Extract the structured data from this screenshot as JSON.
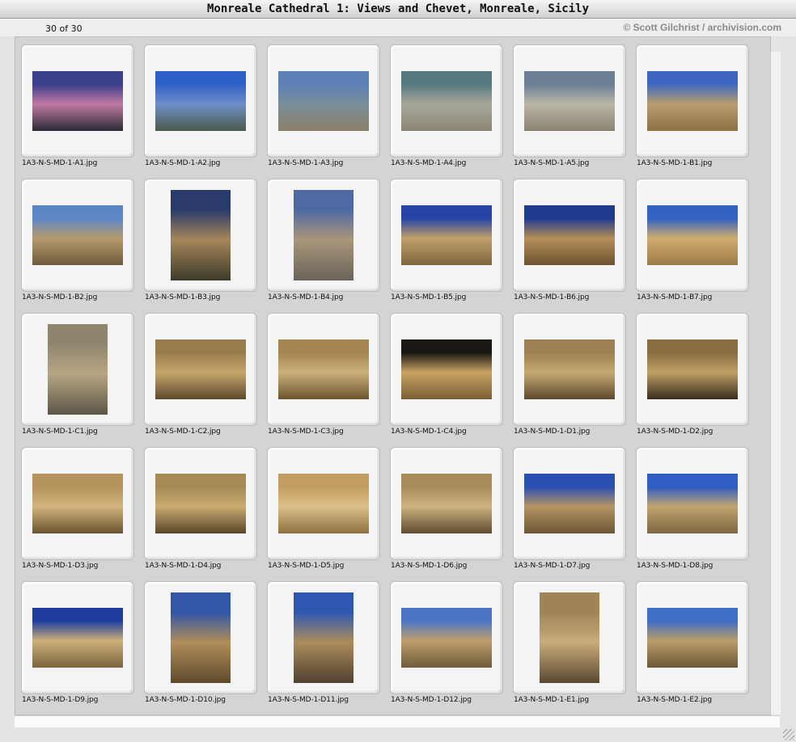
{
  "window": {
    "title": "Monreale Cathedral 1: Views and Chevet, Monreale, Sicily"
  },
  "info": {
    "count": "30 of 30",
    "copyright": "© Scott Gilchrist / archivision.com"
  },
  "images": [
    {
      "filename": "1A3-N-S-MD-1-A1.jpg",
      "orientation": "landscape",
      "colors": [
        "#3b3f8c",
        "#c07aa3",
        "#2b2a35"
      ]
    },
    {
      "filename": "1A3-N-S-MD-1-A2.jpg",
      "orientation": "landscape",
      "colors": [
        "#2e5fc8",
        "#6f8fc9",
        "#4a5a4a"
      ]
    },
    {
      "filename": "1A3-N-S-MD-1-A3.jpg",
      "orientation": "landscape",
      "colors": [
        "#5c7fb6",
        "#7a8f9a",
        "#8a7f6a"
      ]
    },
    {
      "filename": "1A3-N-S-MD-1-A4.jpg",
      "orientation": "landscape",
      "colors": [
        "#577a82",
        "#a7a89a",
        "#8b8575"
      ]
    },
    {
      "filename": "1A3-N-S-MD-1-A5.jpg",
      "orientation": "landscape",
      "colors": [
        "#6b7f95",
        "#bab6a8",
        "#8a836f"
      ]
    },
    {
      "filename": "1A3-N-S-MD-1-B1.jpg",
      "orientation": "landscape",
      "colors": [
        "#3f67c0",
        "#b99d6e",
        "#8c7245"
      ]
    },
    {
      "filename": "1A3-N-S-MD-1-B2.jpg",
      "orientation": "landscape",
      "colors": [
        "#5d86c6",
        "#b59a6d",
        "#6d5a3c"
      ]
    },
    {
      "filename": "1A3-N-S-MD-1-B3.jpg",
      "orientation": "portrait",
      "colors": [
        "#2a3a6b",
        "#a6875a",
        "#3c3a2a"
      ]
    },
    {
      "filename": "1A3-N-S-MD-1-B4.jpg",
      "orientation": "portrait",
      "colors": [
        "#4d6aa3",
        "#a9957a",
        "#6a6458"
      ]
    },
    {
      "filename": "1A3-N-S-MD-1-B5.jpg",
      "orientation": "landscape",
      "colors": [
        "#2544a6",
        "#c1a06a",
        "#7d6540"
      ]
    },
    {
      "filename": "1A3-N-S-MD-1-B6.jpg",
      "orientation": "landscape",
      "colors": [
        "#1f3a8f",
        "#b58e58",
        "#6e5432"
      ]
    },
    {
      "filename": "1A3-N-S-MD-1-B7.jpg",
      "orientation": "landscape",
      "colors": [
        "#3262c2",
        "#d1ad6f",
        "#9b7a46"
      ]
    },
    {
      "filename": "1A3-N-S-MD-1-C1.jpg",
      "orientation": "portrait",
      "colors": [
        "#8f856d",
        "#b8a684",
        "#5c5546"
      ]
    },
    {
      "filename": "1A3-N-S-MD-1-C2.jpg",
      "orientation": "landscape",
      "colors": [
        "#9a7c4c",
        "#c5a56c",
        "#5e4a2b"
      ]
    },
    {
      "filename": "1A3-N-S-MD-1-C3.jpg",
      "orientation": "landscape",
      "colors": [
        "#a4854f",
        "#cbb07a",
        "#6b5530"
      ]
    },
    {
      "filename": "1A3-N-S-MD-1-C4.jpg",
      "orientation": "landscape",
      "colors": [
        "#1b1712",
        "#c9a364",
        "#7a5e35"
      ]
    },
    {
      "filename": "1A3-N-S-MD-1-D1.jpg",
      "orientation": "landscape",
      "colors": [
        "#9e8052",
        "#c6a873",
        "#5d4a2d"
      ]
    },
    {
      "filename": "1A3-N-S-MD-1-D2.jpg",
      "orientation": "landscape",
      "colors": [
        "#8a6d42",
        "#c09e66",
        "#3a2e1d"
      ]
    },
    {
      "filename": "1A3-N-S-MD-1-D3.jpg",
      "orientation": "landscape",
      "colors": [
        "#b4935c",
        "#d2b47d",
        "#6a5330"
      ]
    },
    {
      "filename": "1A3-N-S-MD-1-D4.jpg",
      "orientation": "landscape",
      "colors": [
        "#a88a55",
        "#c9ab72",
        "#5a4628"
      ]
    },
    {
      "filename": "1A3-N-S-MD-1-D5.jpg",
      "orientation": "landscape",
      "colors": [
        "#c29d5f",
        "#dcc089",
        "#8d6f40"
      ]
    },
    {
      "filename": "1A3-N-S-MD-1-D6.jpg",
      "orientation": "landscape",
      "colors": [
        "#a98b5a",
        "#cdb17e",
        "#5d4b30"
      ]
    },
    {
      "filename": "1A3-N-S-MD-1-D7.jpg",
      "orientation": "landscape",
      "colors": [
        "#2a4fb2",
        "#b69563",
        "#6b5634"
      ]
    },
    {
      "filename": "1A3-N-S-MD-1-D8.jpg",
      "orientation": "landscape",
      "colors": [
        "#2f5dc4",
        "#c2a470",
        "#7e6743"
      ]
    },
    {
      "filename": "1A3-N-S-MD-1-D9.jpg",
      "orientation": "landscape",
      "colors": [
        "#1e3d9e",
        "#cdb07a",
        "#7a6440"
      ]
    },
    {
      "filename": "1A3-N-S-MD-1-D10.jpg",
      "orientation": "portrait",
      "colors": [
        "#3256a8",
        "#b08d58",
        "#5e4a2c"
      ]
    },
    {
      "filename": "1A3-N-S-MD-1-D11.jpg",
      "orientation": "portrait",
      "colors": [
        "#2e58b0",
        "#ad8d5c",
        "#4f4030"
      ]
    },
    {
      "filename": "1A3-N-S-MD-1-D12.jpg",
      "orientation": "landscape",
      "colors": [
        "#4b76c6",
        "#c0a06d",
        "#6f5a3a"
      ]
    },
    {
      "filename": "1A3-N-S-MD-1-E1.jpg",
      "orientation": "portrait",
      "colors": [
        "#a08458",
        "#c8ab78",
        "#5a4830"
      ]
    },
    {
      "filename": "1A3-N-S-MD-1-E2.jpg",
      "orientation": "landscape",
      "colors": [
        "#3f6ec6",
        "#bc9d69",
        "#6c5838"
      ]
    }
  ]
}
